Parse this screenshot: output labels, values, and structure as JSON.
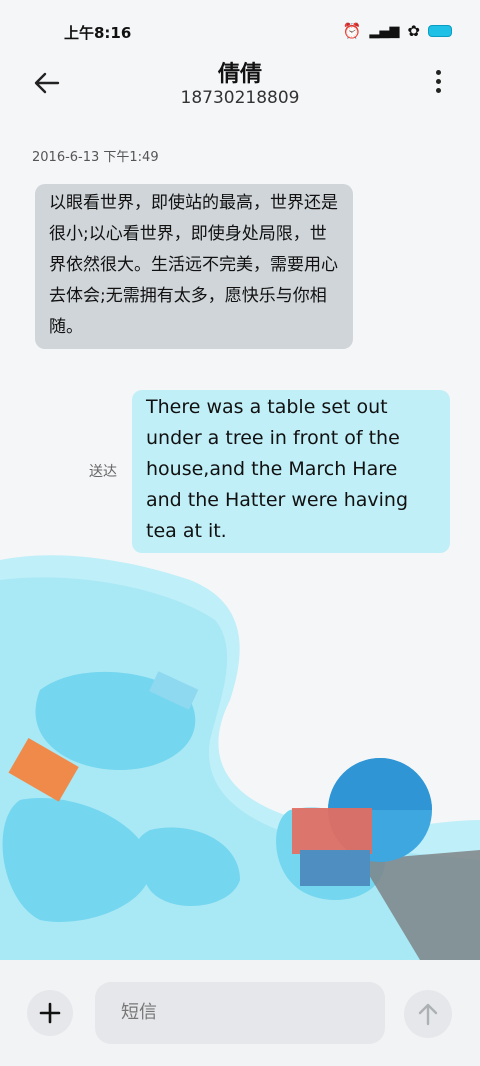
{
  "status": {
    "time": "上午8:16"
  },
  "header": {
    "title": "倩倩",
    "subtitle": "18730218809"
  },
  "conversation": {
    "timestamp": "2016-6-13 下午1:49",
    "incoming_message": "以眼看世界，即使站的最高，世界还是很小;以心看世界，即使身处局限，世界依然很大。生活远不完美，需要用心去体会;无需拥有太多，愿快乐与你相随。",
    "outgoing_message": "There was a table set out under a tree in front of the house,and the March Hare and the Hatter were having tea at it.",
    "delivery_status": "送达"
  },
  "composer": {
    "placeholder": "短信"
  },
  "colors": {
    "accent": "#1ec0e6",
    "incoming_bubble": "#d0d5d9",
    "outgoing_bubble": "#bfeff8"
  }
}
